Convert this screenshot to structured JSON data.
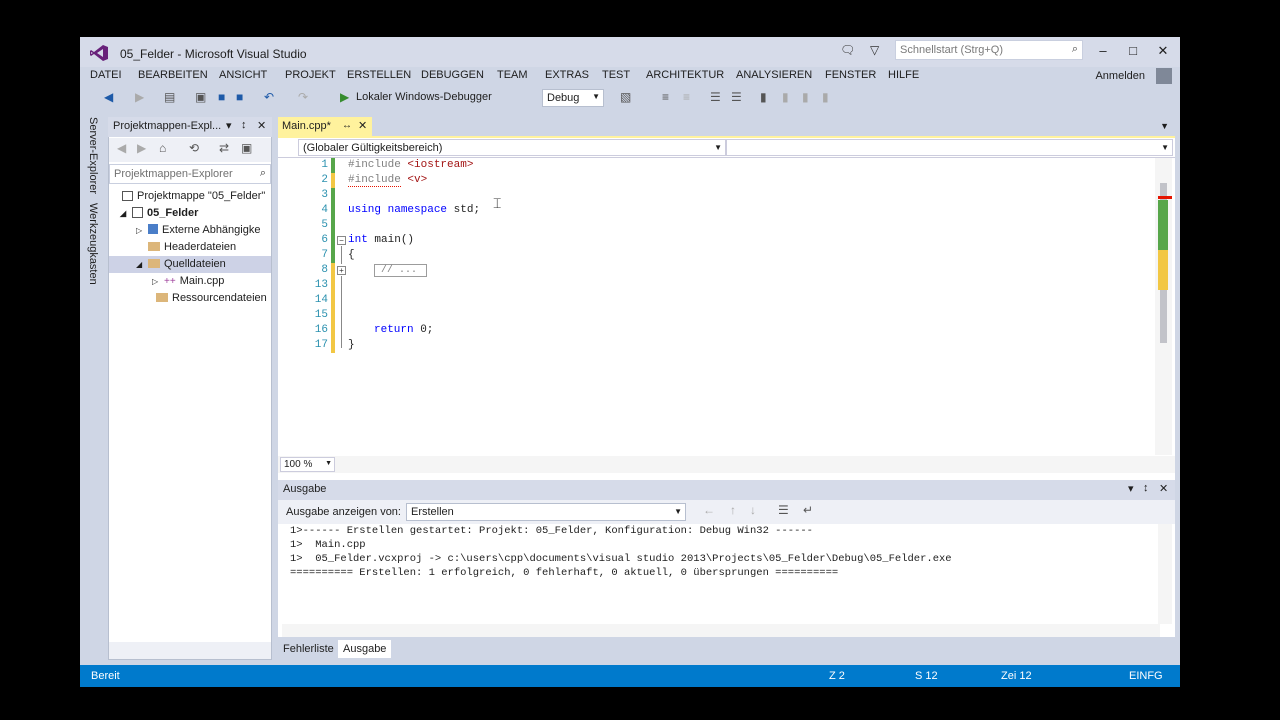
{
  "window": {
    "title": "05_Felder - Microsoft Visual Studio",
    "quick_launch_placeholder": "Schnellstart (Strg+Q)",
    "sign_in": "Anmelden"
  },
  "menu": [
    "DATEI",
    "BEARBEITEN",
    "ANSICHT",
    "PROJEKT",
    "ERSTELLEN",
    "DEBUGGEN",
    "TEAM",
    "EXTRAS",
    "TEST",
    "ARCHITEKTUR",
    "ANALYSIEREN",
    "FENSTER",
    "HILFE"
  ],
  "toolbar": {
    "debugger_label": "Lokaler Windows-Debugger",
    "configuration": "Debug"
  },
  "side_tabs": [
    "Server-Explorer",
    "Werkzeugkasten"
  ],
  "solution_explorer": {
    "title": "Projektmappen-Expl...",
    "search_placeholder": "Projektmappen-Explorer",
    "items": [
      {
        "label": "Projektmappe \"05_Felder\"",
        "type": "solution"
      },
      {
        "label": "05_Felder",
        "type": "project"
      },
      {
        "label": "Externe Abhängigke",
        "type": "external"
      },
      {
        "label": "Headerdateien",
        "type": "folder"
      },
      {
        "label": "Quelldateien",
        "type": "folder"
      },
      {
        "label": "Main.cpp",
        "type": "cpp"
      },
      {
        "label": "Ressourcendateien",
        "type": "folder"
      }
    ]
  },
  "editor": {
    "tab_label": "Main.cpp*",
    "scope": "(Globaler Gültigkeitsbereich)",
    "zoom": "100 %",
    "line_numbers": [
      "1",
      "2",
      "3",
      "4",
      "5",
      "6",
      "7",
      "8",
      "13",
      "14",
      "15",
      "16",
      "17"
    ],
    "collapsed_text": "// ...",
    "lines": {
      "l1_pp": "#include",
      "l1_rest": " <iostream>",
      "l2_pp": "#include",
      "l2_rest": " <v>",
      "l4_kw1": "using",
      "l4_kw2": "namespace",
      "l4_rest": " std;",
      "l6_kw": "int",
      "l6_rest": " main()",
      "l7": "{",
      "l16_kw": "return",
      "l16_rest": " 0;",
      "l17": "}"
    }
  },
  "output": {
    "title": "Ausgabe",
    "show_from_label": "Ausgabe anzeigen von:",
    "source": "Erstellen",
    "lines": [
      "1>------ Erstellen gestartet: Projekt: 05_Felder, Konfiguration: Debug Win32 ------",
      "1>  Main.cpp",
      "1>  05_Felder.vcxproj -> c:\\users\\cpp\\documents\\visual studio 2013\\Projects\\05_Felder\\Debug\\05_Felder.exe",
      "========== Erstellen: 1 erfolgreich, 0 fehlerhaft, 0 aktuell, 0 übersprungen =========="
    ]
  },
  "bottom_tabs": [
    "Fehlerliste",
    "Ausgabe"
  ],
  "status": {
    "state": "Bereit",
    "line": "Z 2",
    "col": "S 12",
    "char": "Zei 12",
    "mode": "EINFG"
  },
  "colors": {
    "status_bar": "#007acc",
    "tab_active": "#fff29d",
    "chrome": "#cfd6e5"
  }
}
